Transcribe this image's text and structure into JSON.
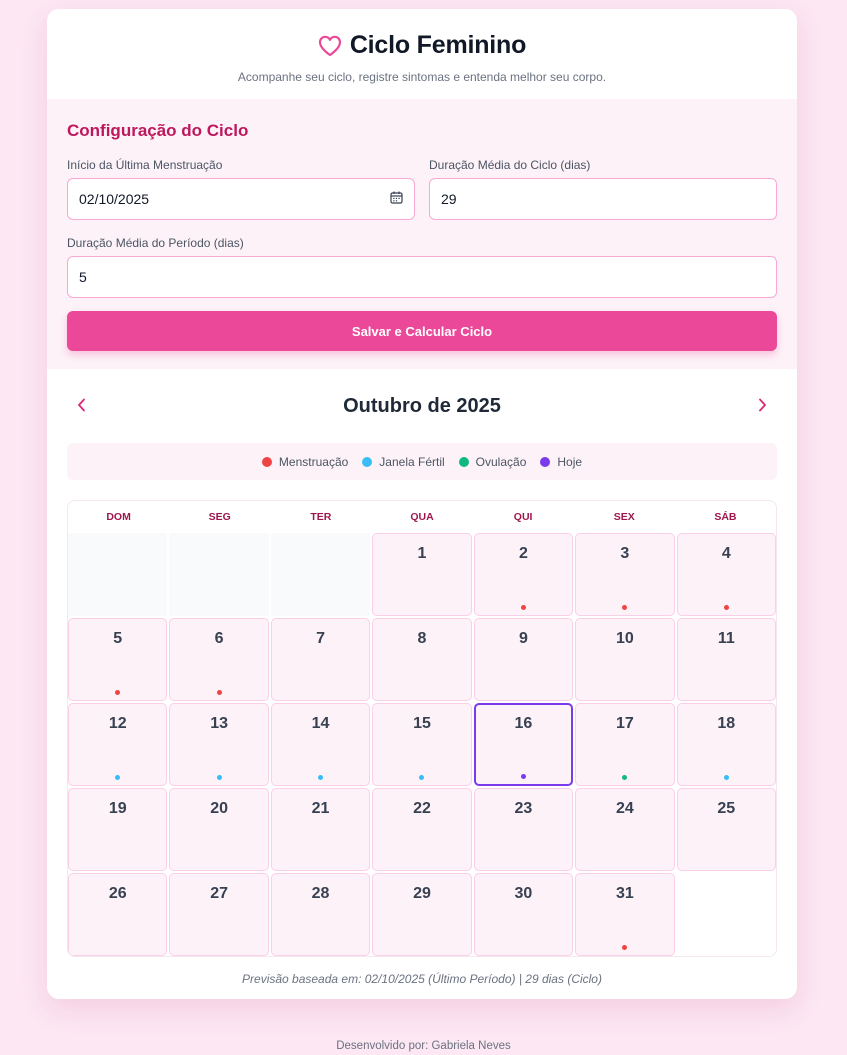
{
  "header": {
    "title": "Ciclo Feminino",
    "subtitle": "Acompanhe seu ciclo, registre sintomas e entenda melhor seu corpo.",
    "icon": "heart-icon"
  },
  "config": {
    "section_title": "Configuração do Ciclo",
    "last_period_label": "Início da Última Menstruação",
    "last_period_value": "02/10/2025",
    "cycle_length_label": "Duração Média do Ciclo (dias)",
    "cycle_length_value": "29",
    "period_length_label": "Duração Média do Período (dias)",
    "period_length_value": "5",
    "save_label": "Salvar e Calcular Ciclo"
  },
  "calendar": {
    "month_title": "Outubro de 2025",
    "prev_icon": "‹",
    "next_icon": "›",
    "legend": [
      {
        "label": "Menstruação",
        "color": "#ef4444"
      },
      {
        "label": "Janela Fértil",
        "color": "#38bdf8"
      },
      {
        "label": "Ovulação",
        "color": "#10b981"
      },
      {
        "label": "Hoje",
        "color": "#7c3aed"
      }
    ],
    "weekdays": [
      "DOM",
      "SEG",
      "TER",
      "QUA",
      "QUI",
      "SEX",
      "SÁB"
    ],
    "leading_blanks": 3,
    "trailing_blanks": 1,
    "days": [
      {
        "n": "1",
        "mark": ""
      },
      {
        "n": "2",
        "mark": "menstruation"
      },
      {
        "n": "3",
        "mark": "menstruation"
      },
      {
        "n": "4",
        "mark": "menstruation"
      },
      {
        "n": "5",
        "mark": "menstruation"
      },
      {
        "n": "6",
        "mark": "menstruation"
      },
      {
        "n": "7",
        "mark": ""
      },
      {
        "n": "8",
        "mark": ""
      },
      {
        "n": "9",
        "mark": ""
      },
      {
        "n": "10",
        "mark": ""
      },
      {
        "n": "11",
        "mark": ""
      },
      {
        "n": "12",
        "mark": "fertile"
      },
      {
        "n": "13",
        "mark": "fertile"
      },
      {
        "n": "14",
        "mark": "fertile"
      },
      {
        "n": "15",
        "mark": "fertile"
      },
      {
        "n": "16",
        "mark": "today"
      },
      {
        "n": "17",
        "mark": "ovulation"
      },
      {
        "n": "18",
        "mark": "fertile"
      },
      {
        "n": "19",
        "mark": ""
      },
      {
        "n": "20",
        "mark": ""
      },
      {
        "n": "21",
        "mark": ""
      },
      {
        "n": "22",
        "mark": ""
      },
      {
        "n": "23",
        "mark": ""
      },
      {
        "n": "24",
        "mark": ""
      },
      {
        "n": "25",
        "mark": ""
      },
      {
        "n": "26",
        "mark": ""
      },
      {
        "n": "27",
        "mark": ""
      },
      {
        "n": "28",
        "mark": ""
      },
      {
        "n": "29",
        "mark": ""
      },
      {
        "n": "30",
        "mark": ""
      },
      {
        "n": "31",
        "mark": "menstruation"
      }
    ],
    "mark_colors": {
      "menstruation": "#ef4444",
      "fertile": "#38bdf8",
      "ovulation": "#10b981",
      "today": "#7c3aed"
    },
    "footnote": "Previsão baseada em: 02/10/2025 (Último Período) | 29 dias (Ciclo)"
  },
  "footer": {
    "credits": "Desenvolvido por: Gabriela Neves"
  }
}
